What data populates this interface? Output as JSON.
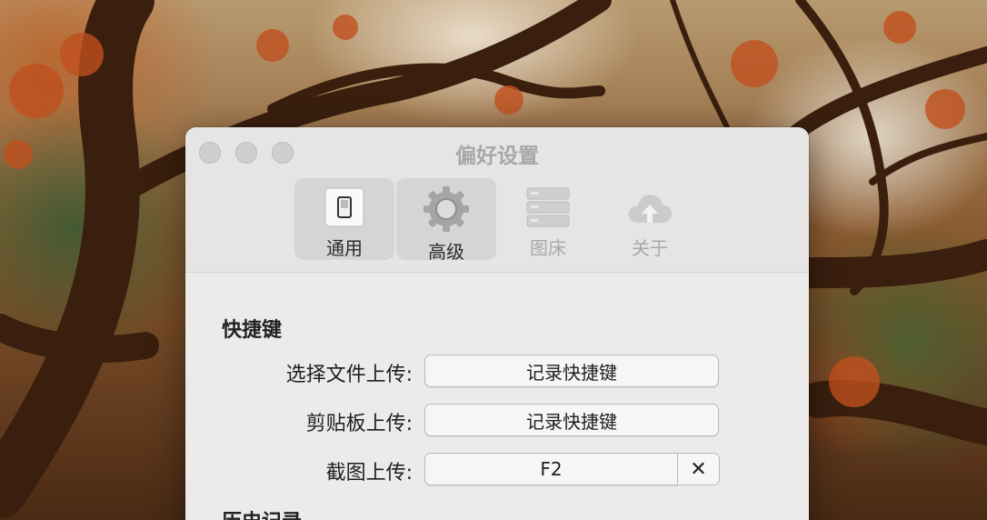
{
  "window": {
    "title": "偏好设置"
  },
  "toolbar": {
    "tabs": [
      {
        "label": "通用",
        "icon": "switch-icon",
        "state": "selected"
      },
      {
        "label": "高级",
        "icon": "gear-icon",
        "state": "hover"
      },
      {
        "label": "图床",
        "icon": "server-icon",
        "state": "disabled"
      },
      {
        "label": "关于",
        "icon": "cloud-upload-icon",
        "state": "disabled"
      }
    ]
  },
  "shortcuts": {
    "section_title": "快捷键",
    "rows": [
      {
        "label": "选择文件上传:",
        "value": "记录快捷键"
      },
      {
        "label": "剪贴板上传:",
        "value": "记录快捷键"
      },
      {
        "label": "截图上传:",
        "value": "F2",
        "clear_label": "✕"
      }
    ]
  },
  "history": {
    "section_title": "历史记录"
  }
}
